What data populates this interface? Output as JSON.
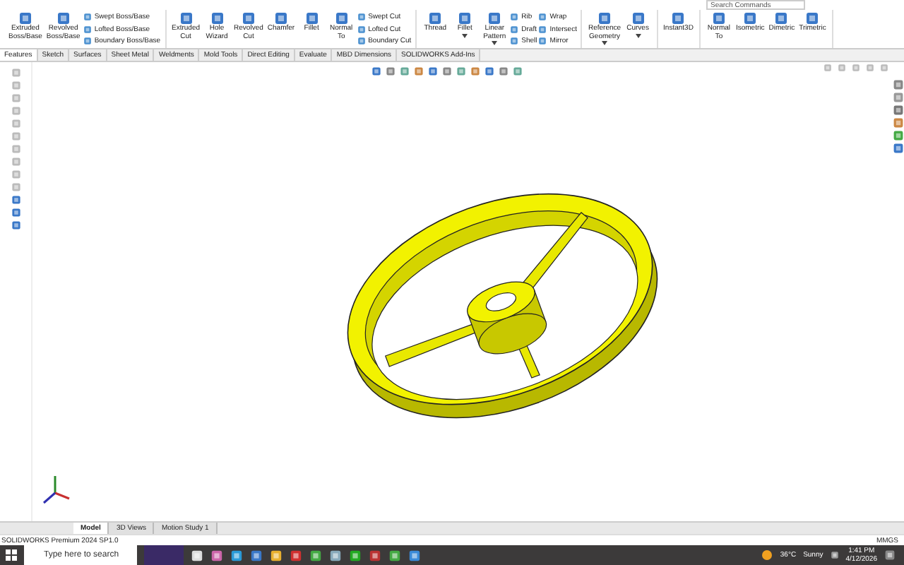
{
  "top_search": {
    "placeholder": "Search Commands"
  },
  "ribbon": {
    "groups": [
      {
        "items": [
          {
            "kind": "large",
            "label": "Extruded\nBoss/Base"
          },
          {
            "kind": "large",
            "label": "Revolved\nBoss/Base"
          },
          {
            "kind": "stack",
            "items": [
              "Swept Boss/Base",
              "Lofted Boss/Base",
              "Boundary Boss/Base"
            ]
          }
        ]
      },
      {
        "items": [
          {
            "kind": "large",
            "label": "Extruded\nCut"
          },
          {
            "kind": "large",
            "label": "Hole\nWizard"
          },
          {
            "kind": "large",
            "label": "Revolved\nCut"
          },
          {
            "kind": "large",
            "label": "Chamfer"
          },
          {
            "kind": "large",
            "label": "Fillet"
          },
          {
            "kind": "large",
            "label": "Normal\nTo"
          },
          {
            "kind": "stack",
            "items": [
              "Swept Cut",
              "Lofted Cut",
              "Boundary Cut"
            ]
          }
        ]
      },
      {
        "items": [
          {
            "kind": "large",
            "label": "Thread"
          },
          {
            "kind": "large",
            "label": "Fillet",
            "dropdown": true
          },
          {
            "kind": "large",
            "label": "Linear\nPattern",
            "dropdown": true
          },
          {
            "kind": "stack",
            "items": [
              "Rib",
              "Draft",
              "Shell"
            ]
          },
          {
            "kind": "stack",
            "items": [
              "Wrap",
              "Intersect",
              "Mirror"
            ]
          }
        ]
      },
      {
        "items": [
          {
            "kind": "large",
            "label": "Reference\nGeometry",
            "dropdown": true
          },
          {
            "kind": "large",
            "label": "Curves",
            "dropdown": true
          }
        ]
      },
      {
        "items": [
          {
            "kind": "large",
            "label": "Instant3D"
          }
        ]
      },
      {
        "items": [
          {
            "kind": "large",
            "label": "Normal\nTo"
          },
          {
            "kind": "large",
            "label": "Isometric"
          },
          {
            "kind": "large",
            "label": "Dimetric"
          },
          {
            "kind": "large",
            "label": "Trimetric"
          }
        ]
      }
    ]
  },
  "tabs": [
    {
      "label": "Features",
      "selected": true
    },
    {
      "label": "Sketch",
      "selected": false
    },
    {
      "label": "Surfaces",
      "selected": false
    },
    {
      "label": "Sheet Metal",
      "selected": false
    },
    {
      "label": "Weldments",
      "selected": false
    },
    {
      "label": "Mold Tools",
      "selected": false
    },
    {
      "label": "Direct Editing",
      "selected": false
    },
    {
      "label": "Evaluate",
      "selected": false
    },
    {
      "label": "MBD Dimensions",
      "selected": false
    },
    {
      "label": "SOLIDWORKS Add-Ins",
      "selected": false
    }
  ],
  "model_tabs": [
    {
      "label": "Model",
      "selected": true
    },
    {
      "label": "3D Views",
      "selected": false
    },
    {
      "label": "Motion Study 1",
      "selected": false
    }
  ],
  "status_bar": {
    "product": "SOLIDWORKS Premium 2024 SP1.0",
    "units": "MMGS"
  },
  "taskbar": {
    "search": {
      "placeholder": "Type here to search"
    },
    "weather": {
      "temperature": "36°C",
      "condition": "Sunny"
    },
    "time": "1:41 PM",
    "date": "4/12/2026"
  }
}
